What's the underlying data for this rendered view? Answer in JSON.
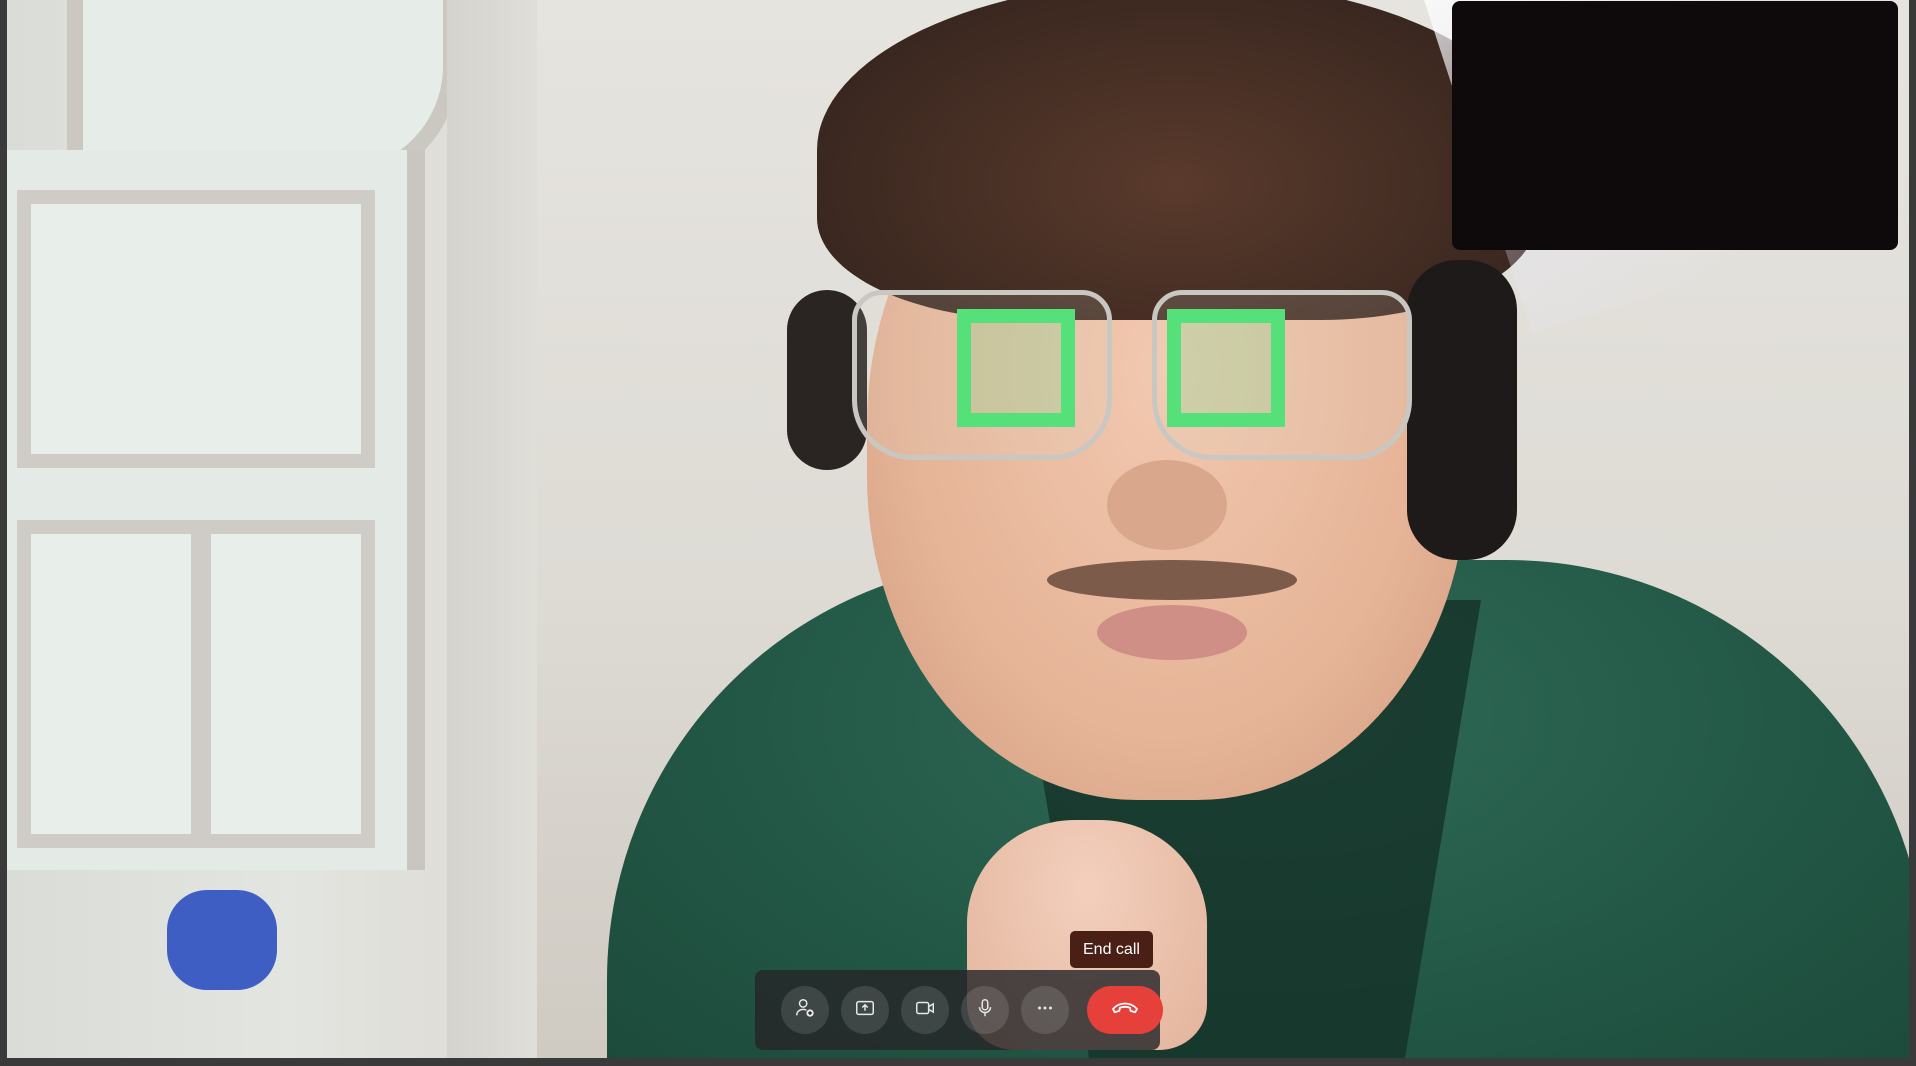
{
  "call": {
    "tooltip_text": "End call"
  },
  "controls": [
    {
      "name": "add-people",
      "icon": "person-add-icon"
    },
    {
      "name": "share-screen",
      "icon": "share-screen-icon"
    },
    {
      "name": "camera",
      "icon": "video-camera-icon"
    },
    {
      "name": "microphone",
      "icon": "microphone-icon"
    },
    {
      "name": "more-options",
      "icon": "more-horizontal-icon"
    },
    {
      "name": "end-call",
      "icon": "phone-hangup-icon"
    }
  ],
  "colors": {
    "end_call": "#e5403a",
    "tooltip_bg": "#4a2016",
    "control_bar_bg": "#262628",
    "self_view_bg": "#0e0a0c"
  }
}
